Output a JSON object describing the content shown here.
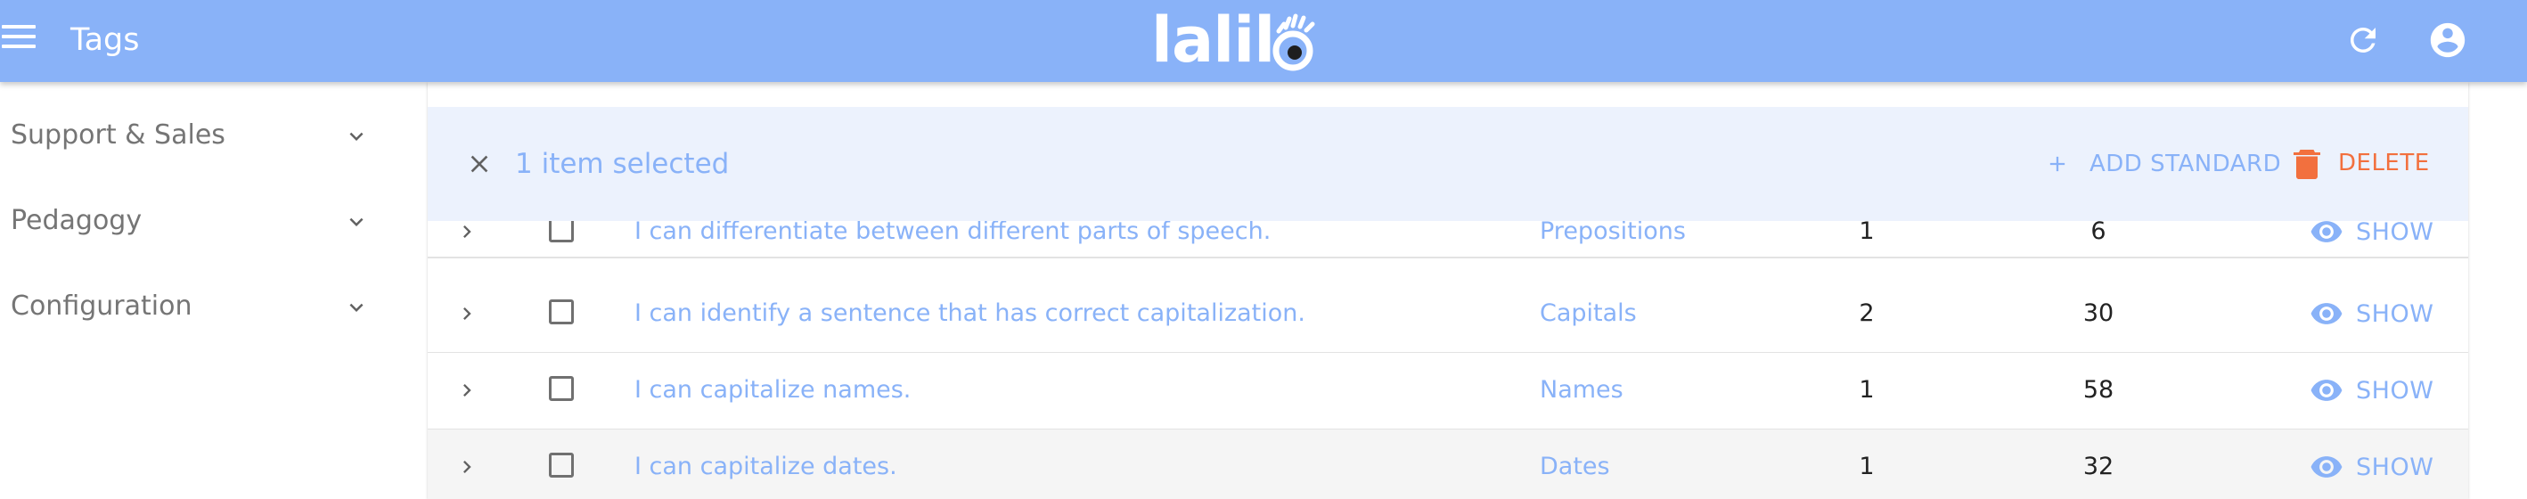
{
  "appbar": {
    "title": "Tags",
    "logo_text": "lalil",
    "menu_icon": "menu-icon",
    "refresh_icon": "refresh-icon",
    "account_icon": "account-circle-icon",
    "color": "#89b2f8"
  },
  "sidebar": {
    "items": [
      {
        "label": "Support & Sales",
        "icon": "chevron-down-icon"
      },
      {
        "label": "Pedagogy",
        "icon": "chevron-down-icon"
      },
      {
        "label": "Configuration",
        "icon": "chevron-down-icon"
      }
    ]
  },
  "selection_toolbar": {
    "count_label": "1 item selected",
    "close_icon": "close-icon",
    "add_label": "ADD STANDARD",
    "add_icon": "plus-icon",
    "delete_label": "DELETE",
    "delete_icon": "trash-icon",
    "background": "#ecf2fd",
    "delete_color": "#f2703e"
  },
  "table": {
    "rows": [
      {
        "title": "I can differentiate between different parts of speech.",
        "tag": "Prepositions",
        "col1": "1",
        "col2": "6",
        "action": "SHOW",
        "checked": false
      },
      {
        "title": "I can identify a sentence that has correct capitalization.",
        "tag": "Capitals",
        "col1": "2",
        "col2": "30",
        "action": "SHOW",
        "checked": false
      },
      {
        "title": "I can capitalize names.",
        "tag": "Names",
        "col1": "1",
        "col2": "58",
        "action": "SHOW",
        "checked": false
      },
      {
        "title": "I can capitalize dates.",
        "tag": "Dates",
        "col1": "1",
        "col2": "32",
        "action": "SHOW",
        "checked": false
      }
    ],
    "row_icons": {
      "expand": "chevron-right-icon",
      "show": "eye-icon"
    }
  }
}
